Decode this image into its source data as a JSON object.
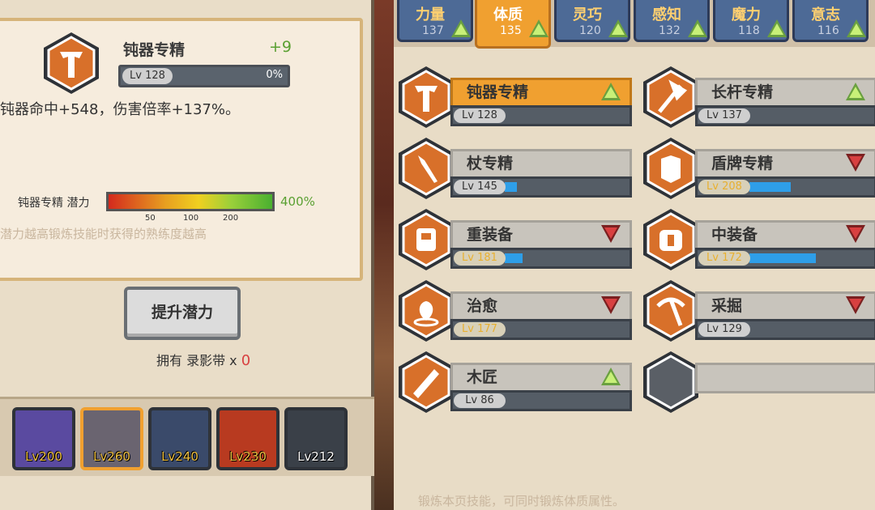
{
  "detail": {
    "skill_name": "钝器专精",
    "bonus": "+9",
    "level": "Lv 128",
    "progress_text": "0%",
    "progress": 0,
    "effect": "钝器命中+548，伤害倍率+137%。",
    "potential_label": "钝器专精 潜力",
    "potential_pct": "400%",
    "ticks": [
      "50",
      "100",
      "200"
    ],
    "potential_note": "潜力越高锻炼技能时获得的熟练度越高",
    "upgrade_button": "提升潜力",
    "tapes_label": "拥有 录影带 x",
    "tapes_count": "0"
  },
  "heroes": [
    {
      "level": "Lv200",
      "color": "#5a4aa0"
    },
    {
      "level": "Lv260",
      "color": "#6a6470",
      "selected": true
    },
    {
      "level": "Lv240",
      "color": "#3a4a6a"
    },
    {
      "level": "Lv230",
      "color": "#b83a20"
    },
    {
      "level": "Lv212",
      "color": "#3a4048"
    }
  ],
  "tabs": [
    {
      "name": "力量",
      "value": "137",
      "active": false
    },
    {
      "name": "体质",
      "value": "135",
      "active": true
    },
    {
      "name": "灵巧",
      "value": "120",
      "active": false
    },
    {
      "name": "感知",
      "value": "132",
      "active": false
    },
    {
      "name": "魔力",
      "value": "118",
      "active": false
    },
    {
      "name": "意志",
      "value": "116",
      "active": false
    }
  ],
  "skills": [
    {
      "name": "钝器专精",
      "level": "Lv 128",
      "fill": 0,
      "trend": "up",
      "selected": true,
      "icon": "hammer-icon"
    },
    {
      "name": "长杆专精",
      "level": "Lv 137",
      "fill": 0,
      "trend": "up",
      "icon": "halberd-icon"
    },
    {
      "name": "杖专精",
      "level": "Lv 145",
      "fill": 0.1,
      "trend": "",
      "icon": "staff-icon"
    },
    {
      "name": "盾牌专精",
      "level": "Lv 208",
      "fill": 0.33,
      "trend": "down",
      "gold": true,
      "icon": "shield-icon"
    },
    {
      "name": "重装备",
      "level": "Lv 181",
      "fill": 0.14,
      "trend": "down",
      "gold": true,
      "icon": "heavy-armor-icon"
    },
    {
      "name": "中装备",
      "level": "Lv 172",
      "fill": 0.53,
      "trend": "down",
      "gold": true,
      "icon": "medium-armor-icon"
    },
    {
      "name": "治愈",
      "level": "Lv 177",
      "fill": 0,
      "trend": "down",
      "gold": true,
      "icon": "heal-icon"
    },
    {
      "name": "采掘",
      "level": "Lv 129",
      "fill": 0,
      "trend": "down",
      "icon": "pickaxe-icon"
    },
    {
      "name": "木匠",
      "level": "Lv 86",
      "fill": 0,
      "trend": "up",
      "icon": "saw-icon"
    }
  ],
  "footer_note": "锻炼本页技能，可同时锻炼体质属性。",
  "colors": {
    "accent": "#f0a030",
    "tab": "#4d6a96",
    "fill": "#2e9ee8"
  }
}
